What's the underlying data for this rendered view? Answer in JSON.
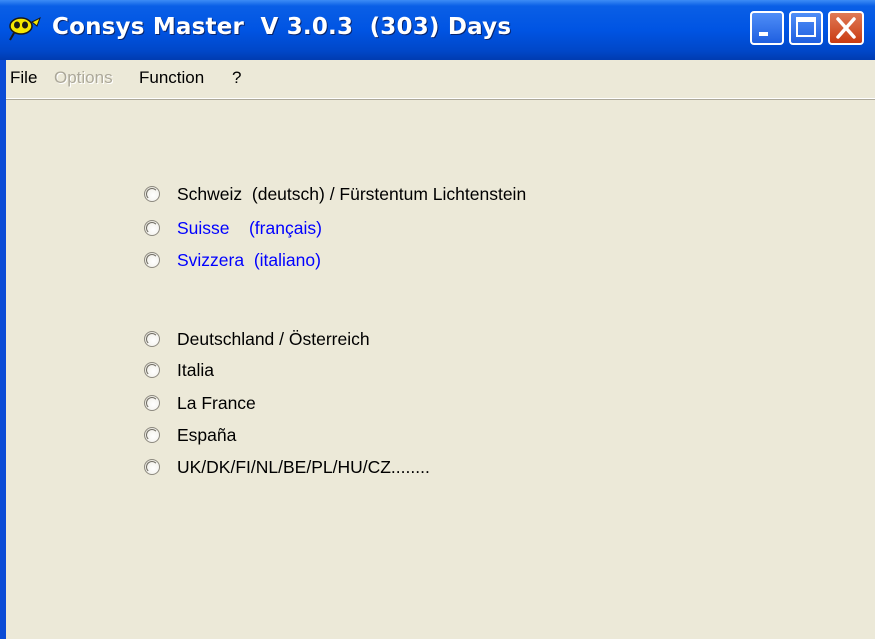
{
  "window": {
    "title": "Consys Master  V 3.0.3  (303) Days",
    "colors": {
      "titlebar": "#0054e3",
      "client": "#ece9d8",
      "close_button": "#c93b12",
      "highlight_text": "#0000ff"
    }
  },
  "menubar": {
    "items": [
      {
        "label": "File",
        "enabled": true
      },
      {
        "label": "Options",
        "enabled": false
      },
      {
        "label": "Function",
        "enabled": true
      },
      {
        "label": "?",
        "enabled": true
      }
    ]
  },
  "country_options": [
    {
      "label": "Schweiz  (deutsch) / Fürstentum Lichtenstein",
      "color": "#000000",
      "selected": false
    },
    {
      "label": "Suisse    (français)",
      "color": "#0000ff",
      "selected": false
    },
    {
      "label": "Svizzera  (italiano)",
      "color": "#0000ff",
      "selected": false
    },
    {
      "label": "Deutschland / Österreich",
      "color": "#000000",
      "selected": false
    },
    {
      "label": "Italia",
      "color": "#000000",
      "selected": false
    },
    {
      "label": "La France",
      "color": "#000000",
      "selected": false
    },
    {
      "label": "España",
      "color": "#000000",
      "selected": false
    },
    {
      "label": "UK/DK/FI/NL/BE/PL/HU/CZ........",
      "color": "#000000",
      "selected": false
    }
  ],
  "icons": {
    "app": "app-logo-icon",
    "minimize": "minimize-icon",
    "maximize": "maximize-icon",
    "close": "close-icon"
  }
}
